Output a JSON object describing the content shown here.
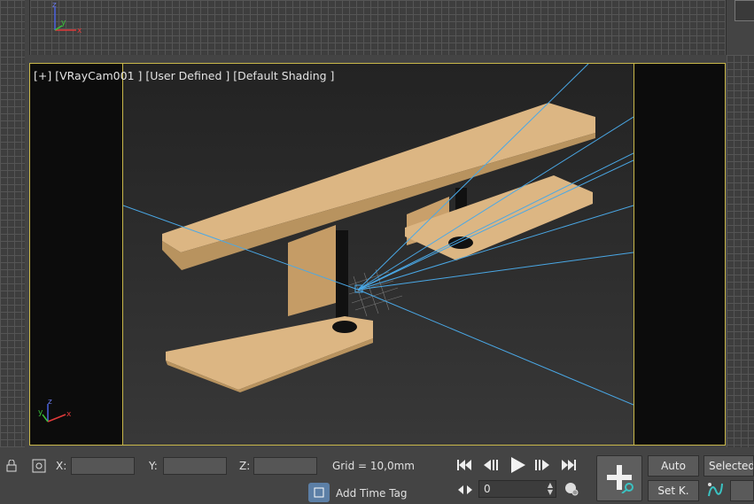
{
  "viewport": {
    "label": "[+] [VRayCam001 ] [User Defined ] [Default Shading ]"
  },
  "status": {
    "x_label": "X:",
    "y_label": "Y:",
    "z_label": "Z:",
    "x_value": "",
    "y_value": "",
    "z_value": "",
    "grid": "Grid = 10,0mm",
    "add_time_tag": "Add Time Tag"
  },
  "playback": {
    "frame_value": "0"
  },
  "keying": {
    "auto": "Auto",
    "set_key": "Set K.",
    "selected": "Selected"
  },
  "axes": {
    "x": "x",
    "y": "y",
    "z": "z"
  },
  "colors": {
    "viewport_border": "#c9b84a",
    "wood": "#e3c08f",
    "camera_lines": "#4aa8e6",
    "axis_x": "#e03a3a",
    "axis_y": "#3ac23a",
    "axis_z": "#4a62e0"
  },
  "icons": {
    "lock": "lock-icon",
    "absolute_mode": "absolute-mode-icon",
    "time_tag": "time-tag-icon",
    "go_start": "go-to-start-icon",
    "prev_frame": "previous-frame-icon",
    "play": "play-icon",
    "next_frame": "next-frame-icon",
    "go_end": "go-to-end-icon",
    "key_mode": "key-mode-icon",
    "time_config": "time-configuration-icon",
    "set_key": "set-key-icon",
    "key_filters": "key-filters-icon"
  }
}
